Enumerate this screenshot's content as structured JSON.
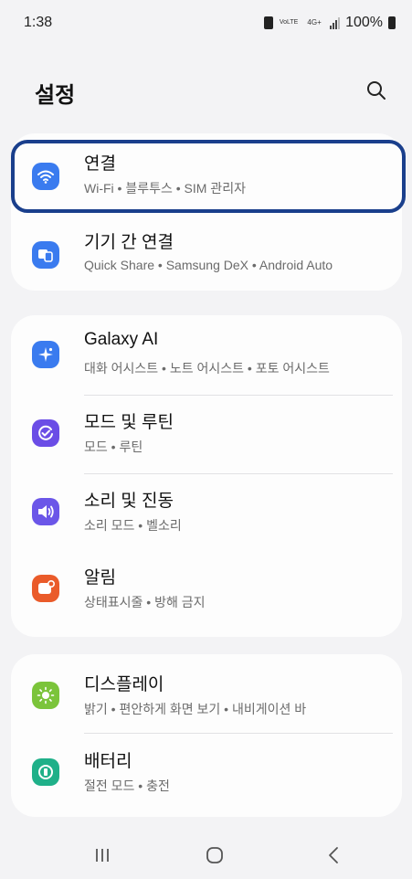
{
  "status_bar": {
    "time": "1:38",
    "network_top": "VoLTE",
    "network_type": "4G+",
    "battery": "100%"
  },
  "header": {
    "title": "설정"
  },
  "groups": [
    {
      "items": [
        {
          "title": "연결",
          "subtitle": "Wi-Fi • 블루투스 • SIM 관리자",
          "icon": "wifi-icon",
          "color": "#3a7bef"
        },
        {
          "title": "기기 간 연결",
          "subtitle": "Quick Share • Samsung DeX • Android Auto",
          "icon": "device-connect-icon",
          "color": "#3a7bef"
        }
      ]
    },
    {
      "items": [
        {
          "title": "Galaxy AI",
          "subtitle": "대화 어시스트 • 노트 어시스트 • 포토 어시스트",
          "icon": "galaxy-ai-sparkle-icon",
          "color": "#3a7bef"
        },
        {
          "title": "모드 및 루틴",
          "subtitle": "모드 • 루틴",
          "icon": "modes-routines-check-icon",
          "color": "#6b4de6"
        },
        {
          "title": "소리 및 진동",
          "subtitle": "소리 모드 • 벨소리",
          "icon": "speaker-icon",
          "color": "#6b56e8"
        },
        {
          "title": "알림",
          "subtitle": "상태표시줄 • 방해 금지",
          "icon": "notification-icon",
          "color": "#ea5b2a"
        }
      ]
    },
    {
      "items": [
        {
          "title": "디스플레이",
          "subtitle": "밝기 • 편안하게 화면 보기 • 내비게이션 바",
          "icon": "display-sun-icon",
          "color": "#7bc43a"
        },
        {
          "title": "배터리",
          "subtitle": "절전 모드 • 충전",
          "icon": "battery-icon",
          "color": "#1fb089"
        }
      ]
    }
  ],
  "highlight": {
    "target": "연결",
    "color": "#1a3f8c"
  },
  "nav_bar": {
    "recents": "recents-icon",
    "home": "home-icon",
    "back": "back-icon"
  }
}
